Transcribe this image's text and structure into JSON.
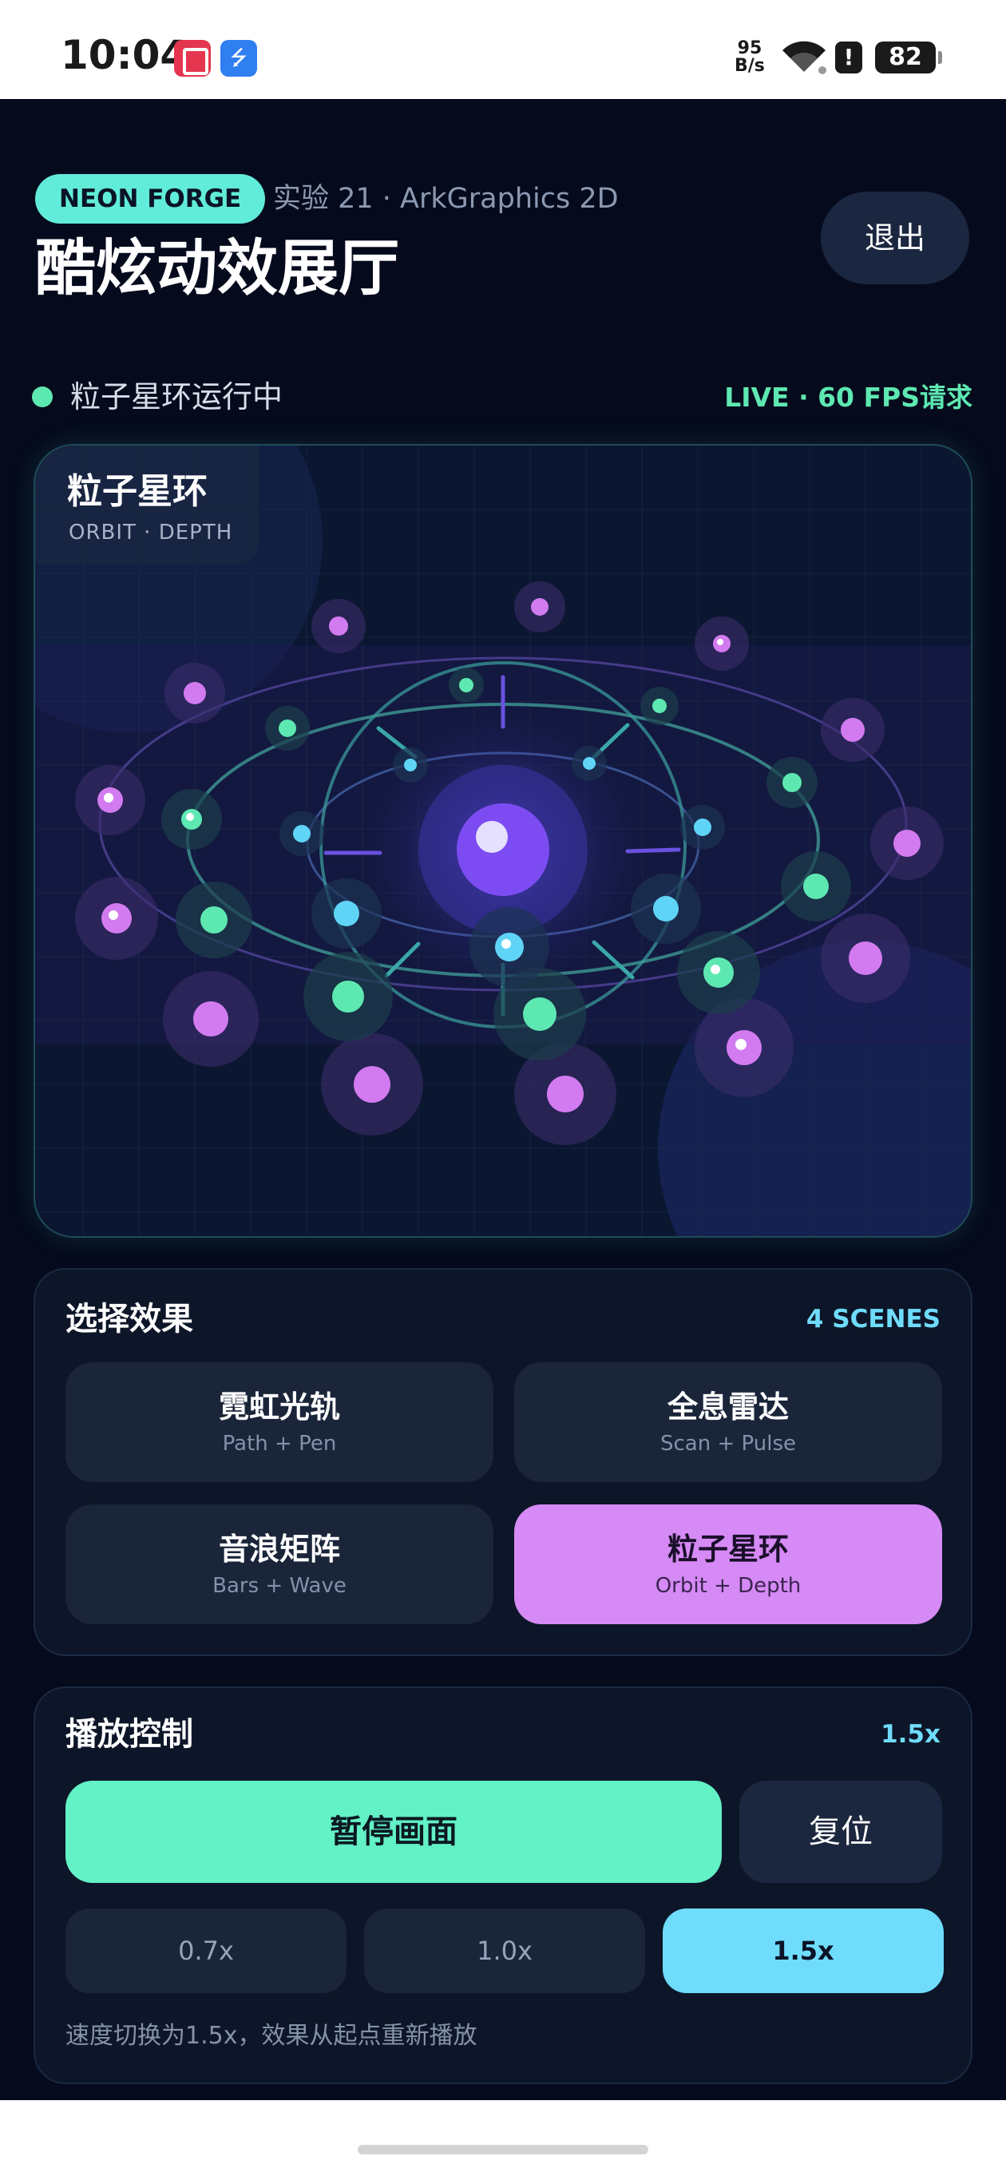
{
  "status_bar": {
    "time": "10:04",
    "net_speed_value": "95",
    "net_speed_unit": "B/s",
    "battery": "82",
    "alert": "!",
    "icons": [
      "notes-app-icon",
      "usb-icon",
      "wifi-icon",
      "alert-icon",
      "battery-icon"
    ]
  },
  "header": {
    "badge": "NEON FORGE",
    "subtitle": "实验 21 · ArkGraphics 2D",
    "title": "酷炫动效展厅",
    "exit_label": "退出"
  },
  "status": {
    "text": "粒子星环运行中",
    "live": "LIVE · 60 FPS请求"
  },
  "canvas": {
    "title": "粒子星环",
    "subtitle": "ORBIT · DEPTH"
  },
  "effects": {
    "heading": "选择效果",
    "count": "4 SCENES",
    "items": [
      {
        "name": "霓虹光轨",
        "desc": "Path + Pen",
        "active": false
      },
      {
        "name": "全息雷达",
        "desc": "Scan + Pulse",
        "active": false
      },
      {
        "name": "音浪矩阵",
        "desc": "Bars + Wave",
        "active": false
      },
      {
        "name": "粒子星环",
        "desc": "Orbit + Depth",
        "active": true
      }
    ]
  },
  "playback": {
    "heading": "播放控制",
    "current_speed": "1.5x",
    "pause_label": "暂停画面",
    "reset_label": "复位",
    "speeds": [
      "0.7x",
      "1.0x",
      "1.5x"
    ],
    "selected_speed": "1.5x",
    "hint": "速度切换为1.5x，效果从起点重新播放"
  },
  "colors": {
    "background": "#050b1c",
    "accent_green": "#5ee8b1",
    "accent_cyan": "#6fdcfc",
    "accent_purple": "#d68af5",
    "panel": "#0d1628"
  }
}
